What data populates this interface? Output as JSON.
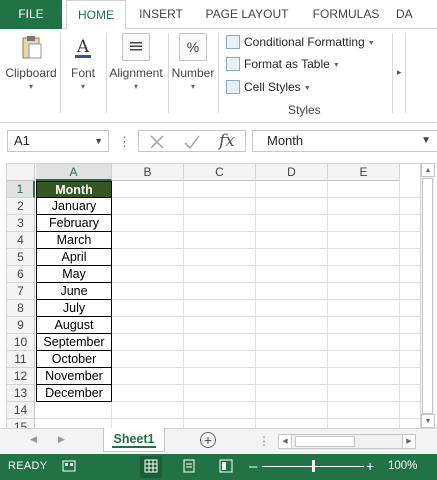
{
  "ribbon_tabs": [
    {
      "label": "FILE"
    },
    {
      "label": "HOME"
    },
    {
      "label": "INSERT"
    },
    {
      "label": "PAGE LAYOUT"
    },
    {
      "label": "FORMULAS"
    },
    {
      "label": "DA"
    }
  ],
  "groups": {
    "clipboard": "Clipboard",
    "font": "Font",
    "alignment": "Alignment",
    "number": "Number",
    "number_symbol": "%",
    "styles": "Styles"
  },
  "styles_items": {
    "conditional": "Conditional Formatting",
    "table": "Format as Table",
    "cell": "Cell Styles"
  },
  "formula_bar": {
    "name_box": "A1",
    "fx": "fx",
    "content": "Month"
  },
  "columns": [
    "A",
    "B",
    "C",
    "D",
    "E"
  ],
  "rows": [
    "1",
    "2",
    "3",
    "4",
    "5",
    "6",
    "7",
    "8",
    "9",
    "10",
    "11",
    "12",
    "13",
    "14",
    "15"
  ],
  "cells": [
    {
      "value": "Month"
    },
    {
      "value": "January"
    },
    {
      "value": "February"
    },
    {
      "value": "March"
    },
    {
      "value": "April"
    },
    {
      "value": "May"
    },
    {
      "value": "June"
    },
    {
      "value": "July"
    },
    {
      "value": "August"
    },
    {
      "value": "September"
    },
    {
      "value": "October"
    },
    {
      "value": "November"
    },
    {
      "value": "December"
    }
  ],
  "sheet_tab": "Sheet1",
  "status": {
    "ready": "READY",
    "zoom": "100%",
    "zoom_level": 1.0
  },
  "colors": {
    "excel_green": "#217346",
    "header_fill": "#375623"
  }
}
